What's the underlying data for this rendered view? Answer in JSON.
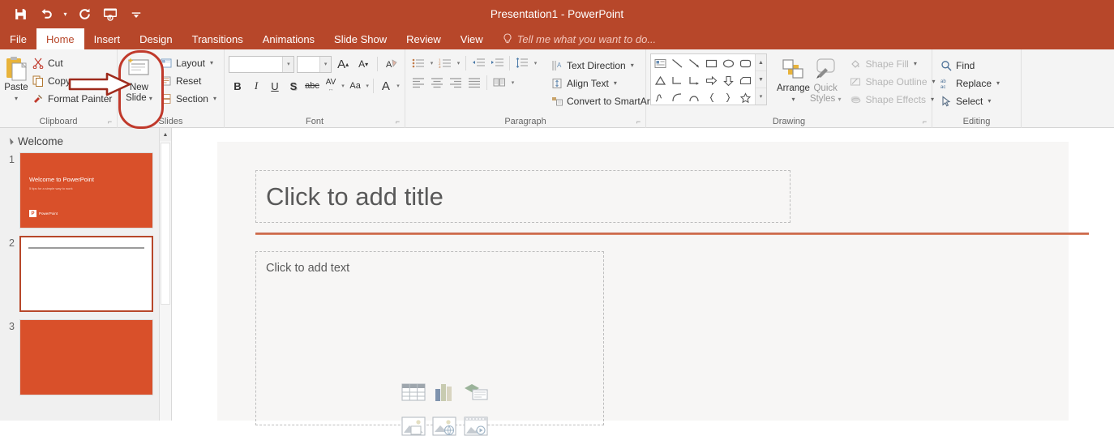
{
  "titlebar": {
    "app_title": "Presentation1 - PowerPoint",
    "accent_color": "#b7472a",
    "qat": [
      {
        "name": "save-icon",
        "label": "Save"
      },
      {
        "name": "undo-icon",
        "label": "Undo"
      },
      {
        "name": "redo-icon",
        "label": "Redo"
      },
      {
        "name": "start-slideshow-icon",
        "label": "Start From Beginning"
      },
      {
        "name": "customize-qat-icon",
        "label": "Customize Quick Access Toolbar"
      }
    ]
  },
  "tabs": [
    {
      "label": "File",
      "active": false
    },
    {
      "label": "Home",
      "active": true
    },
    {
      "label": "Insert",
      "active": false
    },
    {
      "label": "Design",
      "active": false
    },
    {
      "label": "Transitions",
      "active": false
    },
    {
      "label": "Animations",
      "active": false
    },
    {
      "label": "Slide Show",
      "active": false
    },
    {
      "label": "Review",
      "active": false
    },
    {
      "label": "View",
      "active": false
    }
  ],
  "tell_me": "Tell me what you want to do...",
  "ribbon": {
    "clipboard": {
      "label": "Clipboard",
      "paste": "Paste",
      "cut": "Cut",
      "copy": "Copy",
      "format_painter": "Format Painter"
    },
    "slides": {
      "label": "Slides",
      "new_slide_line1": "New",
      "new_slide_line2": "Slide",
      "layout": "Layout",
      "reset": "Reset",
      "section": "Section"
    },
    "font": {
      "label": "Font",
      "font_name_value": "",
      "font_name_placeholder": "",
      "font_size_value": "",
      "font_size_placeholder": "",
      "grow_font": "A",
      "shrink_font": "A",
      "clear_formatting": "Clear All Formatting",
      "bold": "B",
      "italic": "I",
      "underline": "U",
      "shadow": "S",
      "strikethrough": "abc",
      "character_spacing": "AV",
      "change_case": "Aa",
      "font_color": "A"
    },
    "paragraph": {
      "label": "Paragraph",
      "text_direction": "Text Direction",
      "align_text": "Align Text",
      "convert_to_smartart": "Convert to SmartArt"
    },
    "drawing": {
      "label": "Drawing",
      "arrange": "Arrange",
      "quick_styles_line1": "Quick",
      "quick_styles_line2": "Styles",
      "shape_fill": "Shape Fill",
      "shape_outline": "Shape Outline",
      "shape_effects": "Shape Effects",
      "gallery_scroll_up": "▲",
      "gallery_scroll_down": "▼",
      "gallery_scroll_more": "▾"
    },
    "editing": {
      "label": "Editing",
      "find": "Find",
      "replace": "Replace",
      "select": "Select"
    }
  },
  "thumbnails": {
    "section_name": "Welcome",
    "slides": [
      {
        "number": "1",
        "selected": false,
        "style": "orange-title",
        "title": "Welcome to PowerPoint",
        "subtitle": "5 tips for a simple way to work",
        "logo_mark": "P",
        "logo_text": "PowerPoint"
      },
      {
        "number": "2",
        "selected": true,
        "style": "blank-with-line"
      },
      {
        "number": "3",
        "selected": false,
        "style": "orange-fill"
      }
    ]
  },
  "slide_canvas": {
    "title_placeholder": "Click to add title",
    "body_placeholder": "Click to add text",
    "content_icons": [
      {
        "name": "insert-table-icon"
      },
      {
        "name": "insert-chart-icon"
      },
      {
        "name": "insert-smartart-icon"
      },
      {
        "name": "insert-pictures-icon"
      },
      {
        "name": "insert-online-pictures-icon"
      },
      {
        "name": "insert-video-icon"
      }
    ]
  },
  "annotations": {
    "highlight_color": "#c0392b",
    "highlight_target": "New Slide",
    "arrow_target": "New Slide"
  }
}
